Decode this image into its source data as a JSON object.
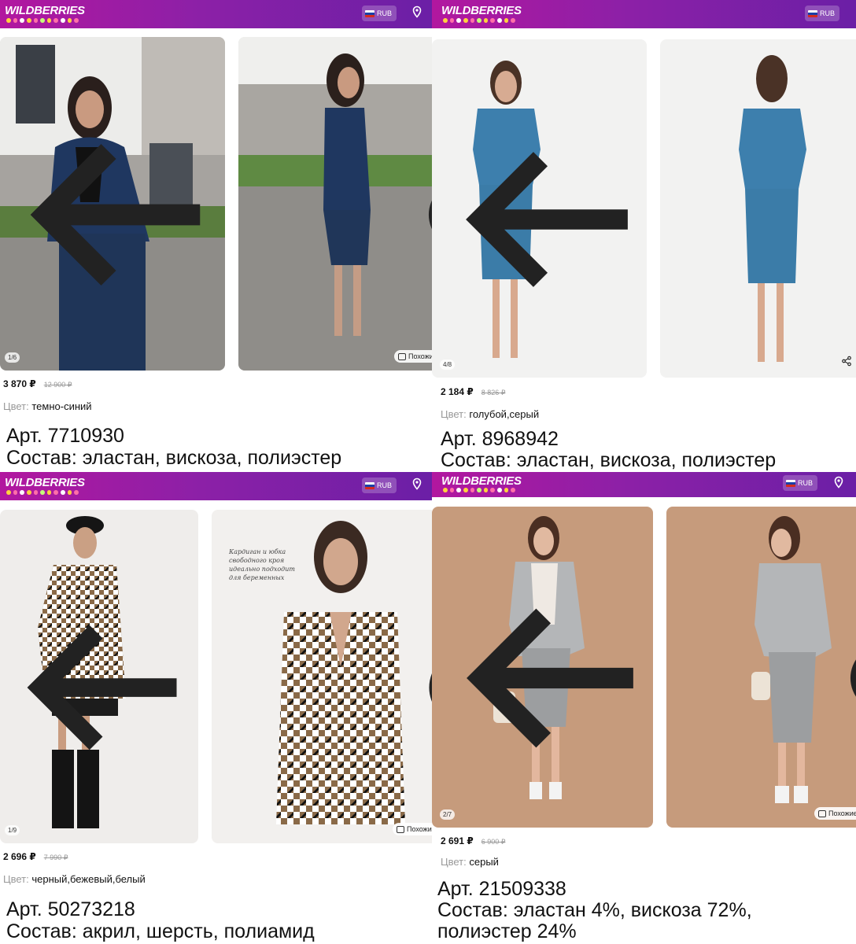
{
  "app": {
    "logo": "WILDBERRIES",
    "currency": "RUB",
    "similar_label": "Похожие"
  },
  "colors": {
    "header_start": "#b2179f",
    "header_end": "#6b1fa6"
  },
  "products": [
    {
      "counter": "1/6",
      "price": "3 870 ₽",
      "old_price": "12 900 ₽",
      "color_label": "Цвет:",
      "color_value": "темно-синий",
      "article": "Арт. 7710930",
      "composition": [
        "Состав: эластан, вискоза, полиэстер"
      ]
    },
    {
      "counter": "4/8",
      "price": "2 184 ₽",
      "old_price": "8 826 ₽",
      "color_label": "Цвет:",
      "color_value": "голубой,серый",
      "article": "Арт. 8968942",
      "composition": [
        "Состав: эластан, вискоза, полиэстер"
      ]
    },
    {
      "counter": "1/9",
      "price": "2 696 ₽",
      "old_price": "7 990 ₽",
      "color_label": "Цвет:",
      "color_value": "черный,бежевый,белый",
      "article": "Арт. 50273218",
      "composition": [
        "Состав: акрил, шерсть, полиамид"
      ],
      "photo_caption": [
        "Кардиган и юбка",
        "свободного кроя",
        "идеально подходит",
        "для беременных"
      ]
    },
    {
      "counter": "2/7",
      "price": "2 691 ₽",
      "old_price": "6 900 ₽",
      "color_label": "Цвет:",
      "color_value": "серый",
      "article": "Арт. 21509338",
      "composition": [
        "Состав: эластан 4%, вискоза 72%,",
        "полиэстер 24%"
      ]
    }
  ]
}
